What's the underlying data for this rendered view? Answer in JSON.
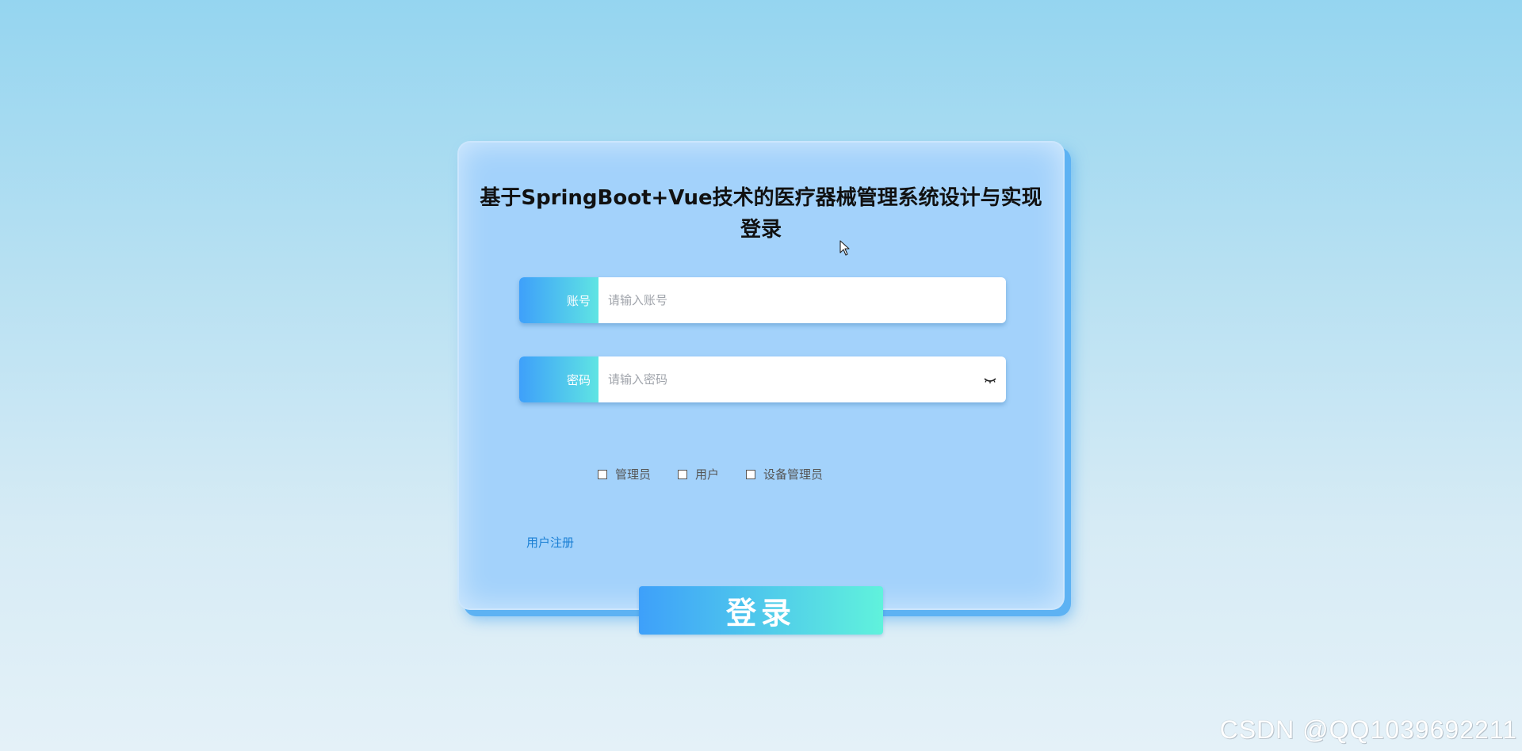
{
  "login_card": {
    "title_line1": "基于SpringBoot+Vue技术的医疗器械管理系统设计与实现",
    "title_line2": "登录"
  },
  "account": {
    "label": "账号",
    "placeholder": "请输入账号",
    "value": ""
  },
  "password": {
    "label": "密码",
    "placeholder": "请输入密码",
    "value": "",
    "toggle_icon": "eye-closed-icon"
  },
  "roles": [
    {
      "label": "管理员",
      "checked": false
    },
    {
      "label": "用户",
      "checked": false
    },
    {
      "label": "设备管理员",
      "checked": false
    }
  ],
  "register_link": "用户注册",
  "login_button": "登录",
  "watermark": "CSDN @QQ1039692211",
  "colors": {
    "accent_start": "#3ea0fa",
    "accent_end": "#5fe4e3",
    "card_bg": "#a3d2fb",
    "link": "#1a7fd4"
  }
}
